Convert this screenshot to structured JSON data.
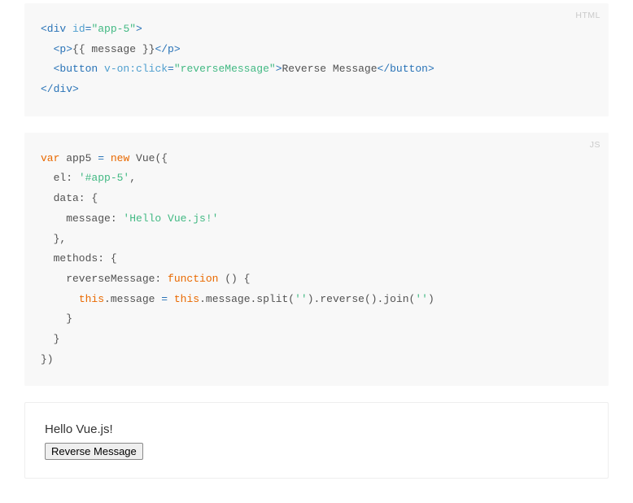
{
  "code1": {
    "lang": "HTML",
    "line1_open": "<div ",
    "line1_attr": "id",
    "line1_eq": "=",
    "line1_val": "\"app-5\"",
    "line1_close": ">",
    "line2_open": "<p>",
    "line2_text": "{{ message }}",
    "line2_close": "</p>",
    "line3_open": "<button ",
    "line3_attr": "v-on:click",
    "line3_eq": "=",
    "line3_val": "\"reverseMessage\"",
    "line3_mid": ">",
    "line3_text": "Reverse Message",
    "line3_close": "</button>",
    "line4": "</div>"
  },
  "code2": {
    "lang": "JS",
    "l1_kw1": "var",
    "l1_sp1": " app5 ",
    "l1_eq": "=",
    "l1_sp2": " ",
    "l1_kw2": "new",
    "l1_rest": " Vue({",
    "l2": "  el: ",
    "l2_val": "'#app-5'",
    "l2_end": ",",
    "l3": "  data: {",
    "l4": "    message: ",
    "l4_val": "'Hello Vue.js!'",
    "l5": "  },",
    "l6": "  methods: {",
    "l7": "    reverseMessage: ",
    "l7_kw": "function",
    "l7_rest": " () {",
    "l8a": "      ",
    "l8_kw1": "this",
    "l8b": ".message ",
    "l8_eq": "=",
    "l8c": " ",
    "l8_kw2": "this",
    "l8d": ".message.split(",
    "l8_str1": "''",
    "l8e": ").reverse().join(",
    "l8_str2": "''",
    "l8f": ")",
    "l9": "    }",
    "l10": "  }",
    "l11": "})"
  },
  "demo": {
    "message": "Hello Vue.js!",
    "button": "Reverse Message"
  }
}
